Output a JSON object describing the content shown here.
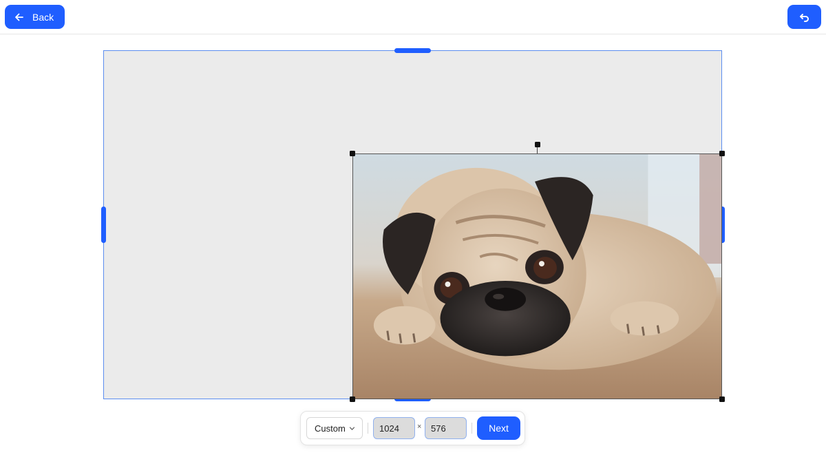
{
  "header": {
    "back_label": "Back",
    "back_icon": "arrow-left-icon",
    "undo_icon": "undo-icon"
  },
  "canvas": {
    "background_color": "#ebebeb",
    "border_color": "#5b8def",
    "accent_color": "#1f5eff",
    "image_subject": "pug-photo"
  },
  "toolbar": {
    "aspect_selected": "Custom",
    "width_value": "1024",
    "height_value": "576",
    "times_symbol": "×",
    "next_label": "Next"
  }
}
